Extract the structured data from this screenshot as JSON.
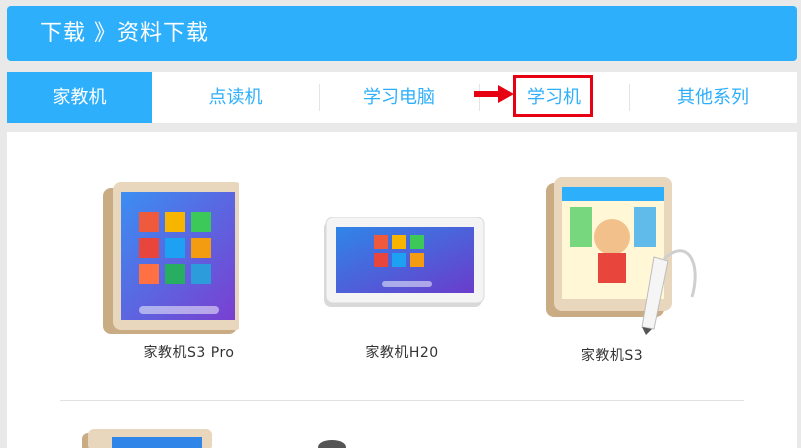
{
  "header": {
    "title": "下载 》资料下载"
  },
  "tabs": [
    {
      "label": "家教机",
      "active": true
    },
    {
      "label": "点读机",
      "active": false
    },
    {
      "label": "学习电脑",
      "active": false
    },
    {
      "label": "学习机",
      "active": false
    },
    {
      "label": "其他系列",
      "active": false
    }
  ],
  "products": [
    {
      "name": "家教机S3 Pro",
      "image": "gold-tablet-portrait"
    },
    {
      "name": "家教机H20",
      "image": "silver-tablet-landscape"
    },
    {
      "name": "家教机S3",
      "image": "gold-tablet-with-pen"
    }
  ],
  "colors": {
    "accent": "#2eaffc",
    "highlight": "#e60012",
    "tablet_gold": "#d9bf9c"
  }
}
